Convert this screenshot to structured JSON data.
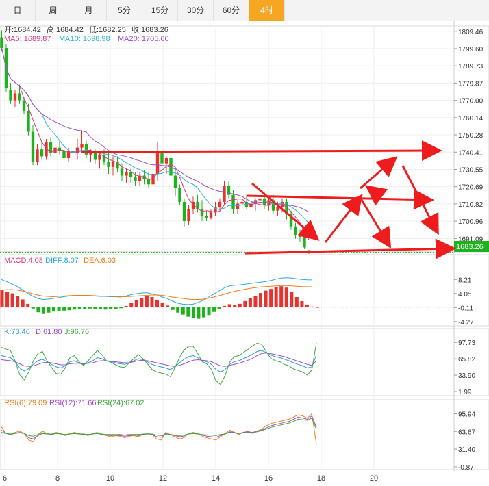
{
  "tabs": [
    {
      "label": "日"
    },
    {
      "label": "周"
    },
    {
      "label": "月"
    },
    {
      "label": "5分"
    },
    {
      "label": "15分"
    },
    {
      "label": "30分"
    },
    {
      "label": "60分"
    },
    {
      "label": "4时",
      "active": true
    }
  ],
  "ohlc": {
    "open": "开:1684.42",
    "high": "高:1684.42",
    "low": "低:1682.25",
    "close": "收:1683.26"
  },
  "ma": {
    "ma5": "MA5: 1689.87",
    "ma10": "MA10: 1698.98",
    "ma20": "MA20: 1705.60"
  },
  "price_badge": "1683.26",
  "macd_legend": {
    "macd": "MACD:4.08",
    "diff": "DIFF:8.07",
    "dea": "DEA:6.03"
  },
  "kdj_legend": {
    "k": "K:73.46",
    "d": "D:61.80",
    "j": "J:96.76"
  },
  "rsi_legend": {
    "rsi6": "RSI(6):79.09",
    "rsi12": "RSI(12):71.66",
    "rsi24": "RSI(24):67.02"
  },
  "colors": {
    "up": "#e8322e",
    "down": "#1db31d",
    "ma5": "#e0317f",
    "ma10": "#2bb3d6",
    "ma20": "#a24bd0",
    "diff": "#2ba7e0",
    "dea": "#ef7e1a",
    "k": "#2b9bd6",
    "d": "#a24bd0",
    "j": "#3aa83a",
    "rsi6": "#ef7e1a",
    "rsi12": "#a24bd0",
    "rsi24": "#3aa83a",
    "annot": "#ee1c1c"
  },
  "chart_data": [
    {
      "type": "candlestick",
      "title": "",
      "x_ticks": [
        "6",
        "8",
        "10",
        "12",
        "14",
        "16",
        "18",
        "20"
      ],
      "y_ticks": [
        1809.46,
        1799.6,
        1789.73,
        1779.87,
        1770.0,
        1760.14,
        1750.28,
        1740.41,
        1730.55,
        1720.69,
        1710.82,
        1700.96,
        1691.09
      ],
      "y_range": [
        1683.4,
        1812.5
      ],
      "candles": [
        [
          1806,
          1810,
          1798,
          1800
        ],
        [
          1800,
          1802,
          1775,
          1777
        ],
        [
          1776,
          1780,
          1768,
          1770
        ],
        [
          1770,
          1776,
          1766,
          1774
        ],
        [
          1774,
          1779,
          1768,
          1770
        ],
        [
          1770,
          1772,
          1762,
          1764
        ],
        [
          1764,
          1768,
          1750,
          1752
        ],
        [
          1752,
          1756,
          1733,
          1735
        ],
        [
          1735,
          1745,
          1733,
          1742
        ],
        [
          1742,
          1746,
          1736,
          1738
        ],
        [
          1738,
          1748,
          1736,
          1746
        ],
        [
          1746,
          1749,
          1738,
          1740
        ],
        [
          1740,
          1746,
          1736,
          1743
        ],
        [
          1743,
          1747,
          1739,
          1741
        ],
        [
          1741,
          1744,
          1734,
          1737
        ],
        [
          1737,
          1743,
          1735,
          1741
        ],
        [
          1741,
          1745,
          1737,
          1740
        ],
        [
          1740,
          1748,
          1736,
          1743
        ],
        [
          1743,
          1753,
          1740,
          1745
        ],
        [
          1745,
          1747,
          1737,
          1739
        ],
        [
          1739,
          1742,
          1735,
          1740
        ],
        [
          1740,
          1742,
          1734,
          1736
        ],
        [
          1736,
          1741,
          1731,
          1739
        ],
        [
          1739,
          1742,
          1733,
          1735
        ],
        [
          1735,
          1740,
          1728,
          1732
        ],
        [
          1732,
          1738,
          1727,
          1735
        ],
        [
          1735,
          1738,
          1729,
          1731
        ],
        [
          1731,
          1734,
          1724,
          1727
        ],
        [
          1727,
          1731,
          1723,
          1729
        ],
        [
          1729,
          1731,
          1723,
          1726
        ],
        [
          1726,
          1729,
          1721,
          1724
        ],
        [
          1724,
          1729,
          1721,
          1727
        ],
        [
          1727,
          1730,
          1722,
          1725
        ],
        [
          1725,
          1729,
          1720,
          1722
        ],
        [
          1722,
          1731,
          1711,
          1728
        ],
        [
          1728,
          1746,
          1724,
          1741
        ],
        [
          1741,
          1744,
          1730,
          1734
        ],
        [
          1734,
          1738,
          1728,
          1737
        ],
        [
          1737,
          1739,
          1725,
          1727
        ],
        [
          1727,
          1730,
          1715,
          1720
        ],
        [
          1720,
          1722,
          1710,
          1712
        ],
        [
          1712,
          1714,
          1698,
          1701
        ],
        [
          1701,
          1710,
          1699,
          1708
        ],
        [
          1708,
          1715,
          1705,
          1712
        ],
        [
          1712,
          1716,
          1706,
          1708
        ],
        [
          1708,
          1713,
          1701,
          1704
        ],
        [
          1704,
          1707,
          1701,
          1703
        ],
        [
          1703,
          1708,
          1702,
          1706
        ],
        [
          1706,
          1712,
          1704,
          1709
        ],
        [
          1709,
          1714,
          1707,
          1712
        ],
        [
          1712,
          1724,
          1710,
          1721
        ],
        [
          1721,
          1724,
          1714,
          1716
        ],
        [
          1716,
          1719,
          1705,
          1708
        ],
        [
          1708,
          1713,
          1705,
          1711
        ],
        [
          1711,
          1714,
          1707,
          1712
        ],
        [
          1712,
          1716,
          1708,
          1709
        ],
        [
          1709,
          1713,
          1706,
          1711
        ],
        [
          1711,
          1714,
          1707,
          1713
        ],
        [
          1713,
          1716,
          1709,
          1714
        ],
        [
          1714,
          1718,
          1708,
          1710
        ],
        [
          1710,
          1715,
          1707,
          1713
        ],
        [
          1713,
          1716,
          1705,
          1707
        ],
        [
          1707,
          1712,
          1704,
          1709
        ],
        [
          1709,
          1714,
          1706,
          1712
        ],
        [
          1712,
          1714,
          1702,
          1705
        ],
        [
          1705,
          1707,
          1696,
          1698
        ],
        [
          1698,
          1700,
          1691,
          1693
        ],
        [
          1693,
          1696,
          1689,
          1692
        ],
        [
          1692,
          1693,
          1685,
          1686
        ],
        [
          1684.42,
          1684.42,
          1682.25,
          1683.26
        ]
      ],
      "horizontal_levels": [
        1740.41,
        1710.82,
        1683.26
      ],
      "last_price": 1683.26
    },
    {
      "type": "macd",
      "y_ticks": [
        8.21,
        4.05,
        -0.11,
        -4.27
      ],
      "y_range": [
        -5.5,
        11.5
      ],
      "histogram": [
        5.2,
        4.6,
        4.1,
        3.4,
        2.3,
        1.0,
        -0.4,
        -1.5,
        -1.8,
        -1.6,
        -1.3,
        -1.1,
        -1.0,
        -0.9,
        -0.7,
        -0.6,
        -0.5,
        -0.4,
        -0.5,
        -0.6,
        -0.7,
        -0.6,
        -0.5,
        -0.3,
        0.4,
        1.2,
        2.1,
        2.8,
        3.4,
        3.0,
        2.2,
        1.3,
        0.5,
        -0.8,
        -1.6,
        -2.2,
        -2.8,
        -3.2,
        -3.4,
        -3.0,
        -2.3,
        -1.4,
        -0.5,
        0.4,
        0.9,
        0.7,
        1.0,
        1.8,
        2.6,
        3.4,
        4.2,
        4.9,
        5.4,
        5.9,
        6.2,
        5.8,
        4.5,
        3.0,
        1.8,
        0.8,
        0.2,
        0.05
      ],
      "diff": [
        8.2,
        7.6,
        6.9,
        6.2,
        5.2,
        4.2,
        3.3,
        2.6,
        2.3,
        2.4,
        2.6,
        2.8,
        3.1,
        3.3,
        3.4,
        3.5,
        3.5,
        3.4,
        3.3,
        3.2,
        3.2,
        3.1,
        3.1,
        3.0,
        3.3,
        3.7,
        4.0,
        4.2,
        4.3,
        4.0,
        3.6,
        3.0,
        2.6,
        1.8,
        1.2,
        0.9,
        0.8,
        0.9,
        1.4,
        2.1,
        3.0,
        3.9,
        4.8,
        5.7,
        6.3,
        6.5,
        6.6,
        6.8,
        7.0,
        7.2,
        7.4,
        7.6,
        7.9,
        8.3,
        8.6,
        8.7,
        8.6,
        8.4,
        8.2,
        8.1,
        8.07
      ],
      "dea": [
        5.0,
        5.2,
        5.2,
        5.1,
        4.8,
        4.5,
        4.0,
        3.6,
        3.3,
        3.2,
        3.1,
        3.2,
        3.3,
        3.4,
        3.5,
        3.5,
        3.5,
        3.5,
        3.4,
        3.3,
        3.3,
        3.2,
        3.2,
        3.1,
        3.1,
        3.2,
        3.3,
        3.4,
        3.5,
        3.6,
        3.6,
        3.5,
        3.3,
        3.0,
        2.8,
        2.6,
        2.4,
        2.3,
        2.3,
        2.4,
        2.7,
        3.0,
        3.4,
        3.8,
        4.3,
        4.7,
        5.0,
        5.3,
        5.6,
        5.8,
        6.0,
        6.1,
        6.2,
        6.3,
        6.4,
        6.4,
        6.3,
        6.2,
        6.1,
        6.05,
        6.03
      ]
    },
    {
      "type": "kdj",
      "y_ticks": [
        97.73,
        65.82,
        33.9,
        1.99
      ],
      "y_range": [
        -6,
        106
      ],
      "k": [
        72,
        70,
        68,
        60,
        48,
        42,
        47,
        55,
        62,
        65,
        60,
        55,
        50,
        48,
        52,
        60,
        62,
        58,
        55,
        58,
        62,
        68,
        66,
        62,
        60,
        58,
        56,
        55,
        58,
        62,
        66,
        64,
        60,
        55,
        52,
        50,
        48,
        45,
        50,
        58,
        65,
        70,
        72,
        68,
        62,
        60,
        55,
        45,
        40,
        45,
        55,
        60,
        62,
        66,
        70,
        75,
        80,
        82,
        78,
        73,
        70,
        68,
        65,
        62,
        58,
        55,
        52,
        48,
        50,
        73.46
      ],
      "d": [
        64,
        63,
        62,
        60,
        56,
        52,
        51,
        52,
        55,
        58,
        59,
        58,
        56,
        54,
        54,
        56,
        57,
        57,
        56,
        57,
        58,
        61,
        62,
        62,
        61,
        60,
        59,
        58,
        58,
        60,
        62,
        63,
        62,
        60,
        58,
        56,
        54,
        52,
        51,
        53,
        56,
        60,
        63,
        64,
        63,
        62,
        60,
        56,
        52,
        51,
        53,
        55,
        57,
        60,
        63,
        67,
        72,
        76,
        77,
        76,
        74,
        72,
        70,
        67,
        64,
        61,
        58,
        55,
        53,
        61.8
      ],
      "j": [
        88,
        85,
        82,
        62,
        35,
        25,
        40,
        62,
        76,
        80,
        62,
        49,
        37,
        36,
        48,
        68,
        72,
        60,
        53,
        62,
        72,
        82,
        74,
        62,
        59,
        54,
        50,
        49,
        58,
        66,
        74,
        66,
        56,
        45,
        40,
        38,
        36,
        31,
        48,
        68,
        83,
        90,
        90,
        76,
        60,
        56,
        45,
        23,
        16,
        33,
        59,
        70,
        72,
        78,
        84,
        91,
        96,
        94,
        80,
        67,
        62,
        60,
        55,
        52,
        46,
        43,
        40,
        34,
        44,
        96.76
      ]
    },
    {
      "type": "rsi",
      "y_ticks": [
        95.94,
        63.67,
        31.4,
        -0.87
      ],
      "y_range": [
        -6,
        104
      ],
      "rsi6": [
        72,
        60,
        58,
        62,
        64,
        60,
        48,
        45,
        58,
        64,
        60,
        58,
        62,
        60,
        56,
        60,
        62,
        60,
        58,
        56,
        60,
        62,
        58,
        56,
        54,
        56,
        55,
        52,
        55,
        56,
        54,
        58,
        60,
        58,
        50,
        48,
        62,
        58,
        54,
        50,
        52,
        60,
        62,
        60,
        55,
        52,
        50,
        48,
        54,
        60,
        66,
        62,
        58,
        62,
        64,
        60,
        64,
        68,
        74,
        78,
        80,
        82,
        84,
        86,
        90,
        94,
        92,
        88,
        96,
        40
      ],
      "rsi12": [
        66,
        60,
        58,
        60,
        62,
        60,
        52,
        50,
        56,
        60,
        59,
        58,
        60,
        59,
        57,
        59,
        60,
        59,
        58,
        57,
        59,
        60,
        58,
        57,
        56,
        57,
        56,
        55,
        56,
        57,
        56,
        58,
        59,
        58,
        54,
        53,
        60,
        58,
        56,
        54,
        55,
        59,
        60,
        59,
        57,
        55,
        54,
        53,
        56,
        59,
        63,
        62,
        60,
        62,
        63,
        62,
        64,
        66,
        70,
        74,
        76,
        78,
        80,
        82,
        86,
        90,
        88,
        86,
        92,
        71.66
      ],
      "rsi24": [
        62,
        60,
        59,
        60,
        61,
        60,
        56,
        55,
        58,
        60,
        59,
        59,
        60,
        59,
        58,
        59,
        60,
        59,
        59,
        58,
        59,
        60,
        59,
        58,
        58,
        58,
        58,
        57,
        58,
        58,
        58,
        59,
        59,
        59,
        57,
        56,
        59,
        58,
        57,
        56,
        57,
        59,
        60,
        59,
        58,
        57,
        57,
        56,
        58,
        59,
        62,
        61,
        60,
        61,
        62,
        61,
        63,
        65,
        68,
        71,
        73,
        75,
        77,
        79,
        82,
        86,
        85,
        84,
        88,
        67.02
      ]
    }
  ]
}
